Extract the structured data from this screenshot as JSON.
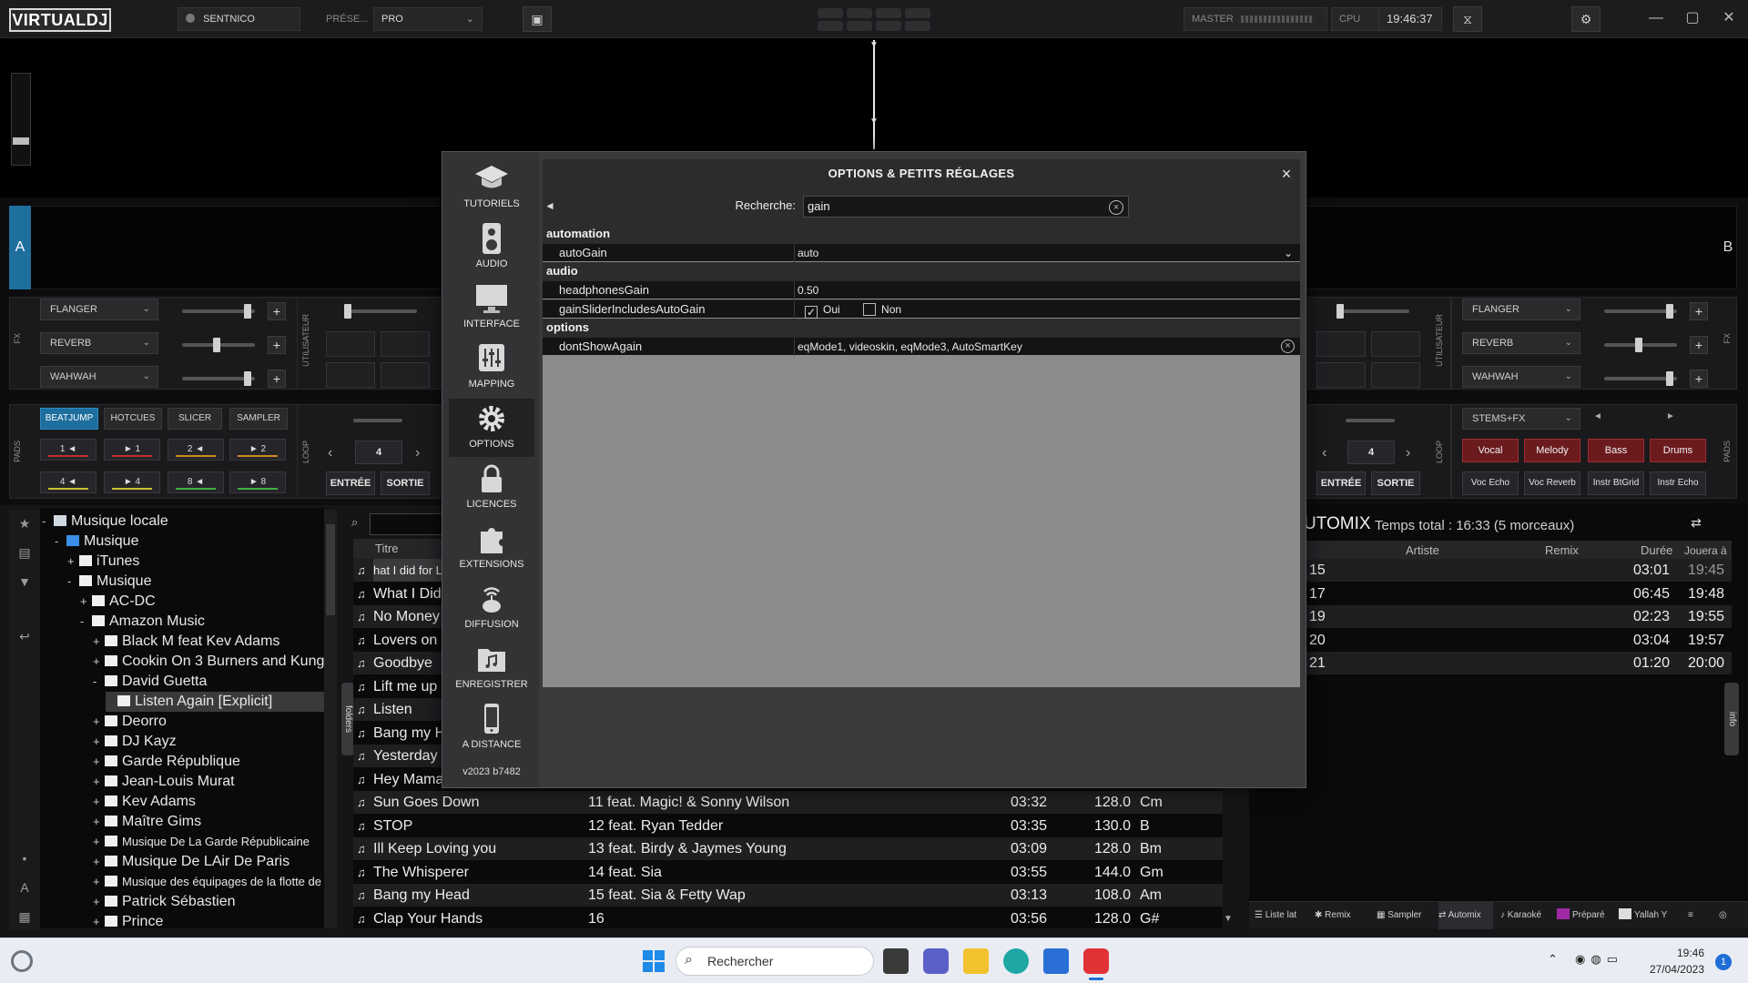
{
  "topbar": {
    "logo": "VIRTUALDJ",
    "user": "SENTNICO",
    "preset_label": "PRÉSE...",
    "preset_value": "PRO",
    "master_label": "MASTER",
    "cpu_label": "CPU",
    "clock": "19:46:37"
  },
  "decks": {
    "left": "A",
    "right": "B"
  },
  "fx_left": {
    "tag": "FX",
    "user_tag": "UTILISATEUR",
    "effects": [
      "FLANGER",
      "REVERB",
      "WAHWAH"
    ]
  },
  "fx_right": {
    "tag": "FX",
    "user_tag": "UTILISATEUR",
    "effects": [
      "FLANGER",
      "REVERB",
      "WAHWAH"
    ]
  },
  "pads_left": {
    "tag": "PADS",
    "loop_tag": "LOOP",
    "modes": [
      "BEATJUMP",
      "HOTCUES",
      "SLICER",
      "SAMPLER"
    ],
    "pads": [
      "1 ◄",
      "► 1",
      "2 ◄",
      "► 2",
      "4 ◄",
      "► 4",
      "8 ◄",
      "► 8"
    ],
    "loop_value": "4",
    "in_label": "ENTRÉE",
    "out_label": "SORTIE"
  },
  "pads_right": {
    "tag": "PADS",
    "loop_tag": "LOOP",
    "stems_label": "STEMS+FX",
    "stems": [
      "Vocal",
      "Melody",
      "Bass",
      "Drums"
    ],
    "stem_fx": [
      "Voc Echo",
      "Voc Reverb",
      "Instr BtGrid",
      "Instr Echo"
    ],
    "loop_value": "4",
    "in_label": "ENTRÉE",
    "out_label": "SORTIE"
  },
  "tree": [
    {
      "label": "Musique locale",
      "exp": "-",
      "level": 0
    },
    {
      "label": "Musique",
      "exp": "-",
      "level": 1
    },
    {
      "label": "iTunes",
      "exp": "+",
      "level": 2
    },
    {
      "label": "Musique",
      "exp": "-",
      "level": 2
    },
    {
      "label": "AC-DC",
      "exp": "+",
      "level": 3
    },
    {
      "label": "Amazon Music",
      "exp": "-",
      "level": 3
    },
    {
      "label": "Black M feat Kev Adams",
      "exp": "+",
      "level": 4
    },
    {
      "label": "Cookin On 3 Burners and Kungs",
      "exp": "+",
      "level": 4
    },
    {
      "label": "David Guetta",
      "exp": "-",
      "level": 4
    },
    {
      "label": "Listen Again [Explicit]",
      "exp": "",
      "level": 5
    },
    {
      "label": "Deorro",
      "exp": "+",
      "level": 4
    },
    {
      "label": "DJ Kayz",
      "exp": "+",
      "level": 4
    },
    {
      "label": "Garde République",
      "exp": "+",
      "level": 4
    },
    {
      "label": "Jean-Louis Murat",
      "exp": "+",
      "level": 4
    },
    {
      "label": "Kev Adams",
      "exp": "+",
      "level": 4
    },
    {
      "label": "Maître Gims",
      "exp": "+",
      "level": 4
    },
    {
      "label": "Musique De La Garde Républicaine",
      "exp": "+",
      "level": 4
    },
    {
      "label": "Musique De LAir De Paris",
      "exp": "+",
      "level": 4
    },
    {
      "label": "Musique des équipages de la flotte de Toulo",
      "exp": "+",
      "level": 4
    },
    {
      "label": "Patrick Sébastien",
      "exp": "+",
      "level": 4
    },
    {
      "label": "Prince",
      "exp": "+",
      "level": 4
    }
  ],
  "folders_tab": "folders",
  "songs": {
    "header_title": "Titre",
    "rows": [
      {
        "title": "hat I did for Lov",
        "remix": "",
        "len": "",
        "bpm": "",
        "key": ""
      },
      {
        "title": "What I Did",
        "remix": "",
        "len": "",
        "bpm": "",
        "key": ""
      },
      {
        "title": "No Money",
        "remix": "",
        "len": "",
        "bpm": "",
        "key": ""
      },
      {
        "title": "Lovers on",
        "remix": "",
        "len": "",
        "bpm": "",
        "key": ""
      },
      {
        "title": "Goodbye",
        "remix": "",
        "len": "",
        "bpm": "",
        "key": ""
      },
      {
        "title": "Lift me up",
        "remix": "",
        "len": "",
        "bpm": "",
        "key": ""
      },
      {
        "title": "Listen",
        "remix": "",
        "len": "",
        "bpm": "",
        "key": ""
      },
      {
        "title": "Bang my H",
        "remix": "",
        "len": "",
        "bpm": "",
        "key": ""
      },
      {
        "title": "Yesterday",
        "remix": "",
        "len": "",
        "bpm": "",
        "key": ""
      },
      {
        "title": "Hey Mama",
        "remix": "",
        "len": "",
        "bpm": "",
        "key": ""
      },
      {
        "title": "Sun Goes Down",
        "remix": "11 feat. Magic! & Sonny Wilson",
        "len": "03:32",
        "bpm": "128.0",
        "key": "Cm"
      },
      {
        "title": "STOP",
        "remix": "12 feat. Ryan Tedder",
        "len": "03:35",
        "bpm": "130.0",
        "key": "B"
      },
      {
        "title": "Ill Keep Loving you",
        "remix": "13 feat. Birdy & Jaymes Young",
        "len": "03:09",
        "bpm": "128.0",
        "key": "Bm"
      },
      {
        "title": "The Whisperer",
        "remix": "14 feat. Sia",
        "len": "03:55",
        "bpm": "144.0",
        "key": "Gm"
      },
      {
        "title": "Bang my Head",
        "remix": "15 feat. Sia & Fetty Wap",
        "len": "03:13",
        "bpm": "108.0",
        "key": "Am"
      },
      {
        "title": "Clap Your Hands",
        "remix": "16",
        "len": "03:56",
        "bpm": "128.0",
        "key": "G#"
      }
    ]
  },
  "automix": {
    "title": "UTOMIX",
    "total": "Temps total : 16:33 (5 morceaux)",
    "headers": [
      "Artiste",
      "Remix",
      "Durée",
      "Jouera à"
    ],
    "rows": [
      {
        "num": "15",
        "dur": "03:01",
        "time": "19:45"
      },
      {
        "num": "17",
        "dur": "06:45",
        "time": "19:48"
      },
      {
        "num": "19",
        "dur": "02:23",
        "time": "19:55"
      },
      {
        "num": "20",
        "dur": "03:04",
        "time": "19:57"
      },
      {
        "num": "21",
        "dur": "01:20",
        "time": "20:00"
      }
    ],
    "info_tab": "info"
  },
  "bottom_tabs": [
    "Liste lat",
    "Remix",
    "Sampler",
    "Automix",
    "Karaoké",
    "Préparé",
    "Yallah Y"
  ],
  "modal": {
    "title": "OPTIONS & PETITS RÉGLAGES",
    "close": "×",
    "nav": [
      "TUTORIELS",
      "AUDIO",
      "INTERFACE",
      "MAPPING",
      "OPTIONS",
      "LICENCES",
      "EXTENSIONS",
      "DIFFUSION",
      "ENREGISTRER",
      "A DISTANCE"
    ],
    "version": "v2023 b7482",
    "search_label": "Recherche:",
    "search_value": "gain",
    "sections": {
      "automation": "automation",
      "audio": "audio",
      "options": "options"
    },
    "rows": {
      "autoGain": {
        "name": "autoGain",
        "value": "auto"
      },
      "headphonesGain": {
        "name": "headphonesGain",
        "value": "0.50"
      },
      "gainSlider": {
        "name": "gainSliderIncludesAutoGain",
        "yes": "Oui",
        "no": "Non"
      },
      "dontShowAgain": {
        "name": "dontShowAgain",
        "value": "eqMode1, videoskin, eqMode3, AutoSmartKey"
      }
    }
  },
  "taskbar": {
    "search_placeholder": "Rechercher",
    "time": "19:46",
    "date": "27/04/2023",
    "notif_count": "1"
  }
}
